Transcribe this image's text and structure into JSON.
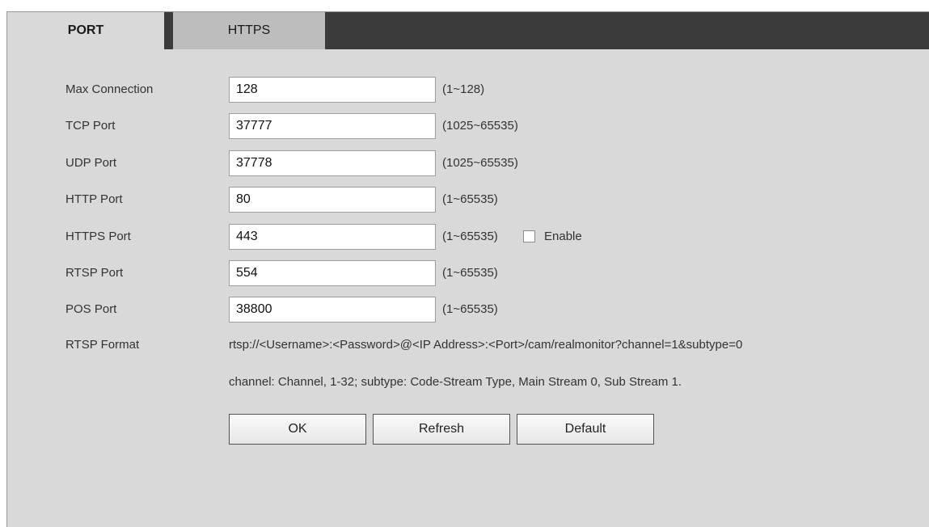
{
  "tabs": [
    {
      "label": "PORT",
      "active": true
    },
    {
      "label": "HTTPS",
      "active": false
    }
  ],
  "fields": {
    "max_connection": {
      "label": "Max Connection",
      "value": "128",
      "range": "(1~128)"
    },
    "tcp_port": {
      "label": "TCP Port",
      "value": "37777",
      "range": "(1025~65535)"
    },
    "udp_port": {
      "label": "UDP Port",
      "value": "37778",
      "range": "(1025~65535)"
    },
    "http_port": {
      "label": "HTTP Port",
      "value": "80",
      "range": "(1~65535)"
    },
    "https_port": {
      "label": "HTTPS Port",
      "value": "443",
      "range": "(1~65535)",
      "enable_label": "Enable",
      "enabled": false
    },
    "rtsp_port": {
      "label": "RTSP Port",
      "value": "554",
      "range": "(1~65535)"
    },
    "pos_port": {
      "label": "POS Port",
      "value": "38800",
      "range": "(1~65535)"
    }
  },
  "rtsp_format": {
    "label": "RTSP Format",
    "url": "rtsp://<Username>:<Password>@<IP Address>:<Port>/cam/realmonitor?channel=1&subtype=0",
    "note": "channel: Channel, 1-32; subtype: Code-Stream Type, Main Stream 0, Sub Stream 1."
  },
  "buttons": {
    "ok": "OK",
    "refresh": "Refresh",
    "default": "Default"
  }
}
